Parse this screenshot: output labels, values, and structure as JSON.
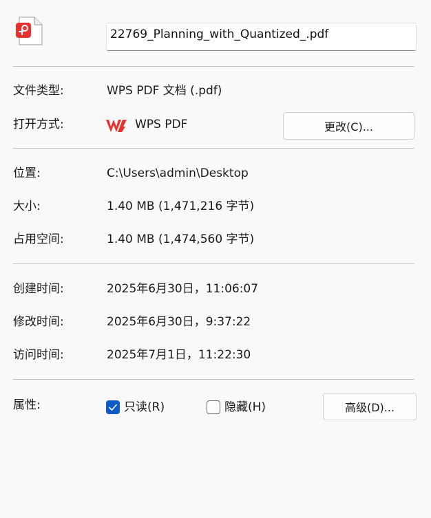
{
  "file": {
    "name": "22769_Planning_with_Quantized_.pdf",
    "icon": "wps-pdf-file-icon"
  },
  "type_section": {
    "file_type_label": "文件类型:",
    "file_type_value": "WPS PDF 文档 (.pdf)",
    "open_with_label": "打开方式:",
    "open_with_app": "WPS PDF",
    "open_with_icon": "wps-logo-icon",
    "change_button": "更改(C)..."
  },
  "location_section": {
    "location_label": "位置:",
    "location_value": "C:\\Users\\admin\\Desktop",
    "size_label": "大小:",
    "size_value": "1.40 MB (1,471,216 字节)",
    "disk_size_label": "占用空间:",
    "disk_size_value": "1.40 MB (1,474,560 字节)"
  },
  "time_section": {
    "created_label": "创建时间:",
    "created_value": "2025年6月30日，11:06:07",
    "modified_label": "修改时间:",
    "modified_value": "2025年6月30日，9:37:22",
    "accessed_label": "访问时间:",
    "accessed_value": "2025年7月1日，11:22:30"
  },
  "attributes": {
    "label": "属性:",
    "readonly_label": "只读(R)",
    "readonly_checked": true,
    "hidden_label": "隐藏(H)",
    "hidden_checked": false,
    "advanced_button": "高级(D)..."
  },
  "colors": {
    "accent": "#0f5bc4",
    "wps_red": "#e8322d"
  }
}
